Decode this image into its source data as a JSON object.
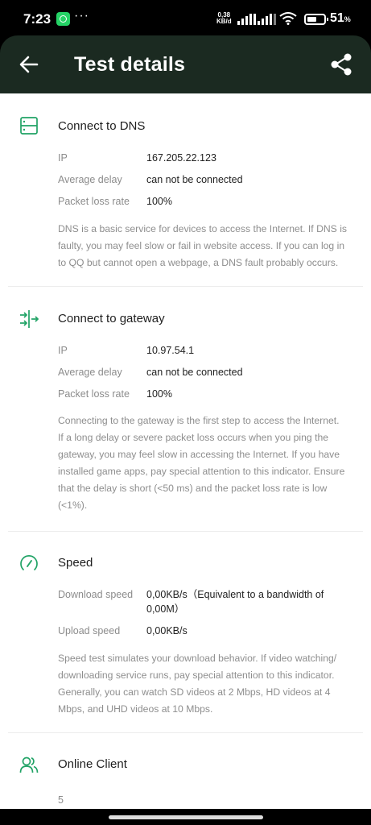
{
  "status_bar": {
    "time": "7:23",
    "more": "···",
    "net_speed_value": "0,38",
    "net_speed_unit": "KB/d",
    "battery_percent": "51",
    "battery_suffix": "%"
  },
  "header": {
    "title": "Test details",
    "background": "#1b2a21"
  },
  "accent_color": "#21a366",
  "sections": {
    "dns": {
      "icon": "server-icon",
      "title": "Connect to DNS",
      "rows": [
        {
          "label": "IP",
          "value": "167.205.22.123"
        },
        {
          "label": "Average delay",
          "value": "can not be connected"
        },
        {
          "label": "Packet loss rate",
          "value": "100%"
        }
      ],
      "description_lines": [
        "DNS is a basic service for devices to access the Internet. If DNS is",
        "faulty, you may feel slow or fail in website access. If you can log in",
        "to QQ but cannot open a webpage, a DNS fault probably occurs."
      ]
    },
    "gateway": {
      "icon": "gateway-icon",
      "title": "Connect to gateway",
      "rows": [
        {
          "label": "IP",
          "value": "10.97.54.1"
        },
        {
          "label": "Average delay",
          "value": "can not be connected"
        },
        {
          "label": "Packet loss rate",
          "value": "100%"
        }
      ],
      "description_lines": [
        "Connecting to the gateway is the first step to access the Internet.",
        "If a long delay or severe packet loss occurs when you ping the",
        "gateway, you may feel slow in accessing the Internet. If you have",
        "installed game apps, pay special attention to this indicator. Ensure",
        "that the delay is short (<50 ms) and the packet loss rate is low",
        "(<1%)."
      ]
    },
    "speed": {
      "icon": "speedometer-icon",
      "title": "Speed",
      "rows": [
        {
          "label": "Download speed",
          "value_lines": [
            "0,00KB/s（Equivalent to a bandwidth of",
            "0,00M）"
          ]
        },
        {
          "label": "Upload speed",
          "value": "0,00KB/s"
        }
      ],
      "description_lines": [
        "Speed test simulates your download behavior. If video watching/",
        "downloading service runs, pay special attention to this indicator.",
        "Generally, you can watch SD videos at 2 Mbps, HD videos at 4",
        "Mbps, and UHD videos at 10 Mbps."
      ]
    },
    "clients": {
      "icon": "users-icon",
      "title": "Online Client",
      "count": "5"
    }
  }
}
